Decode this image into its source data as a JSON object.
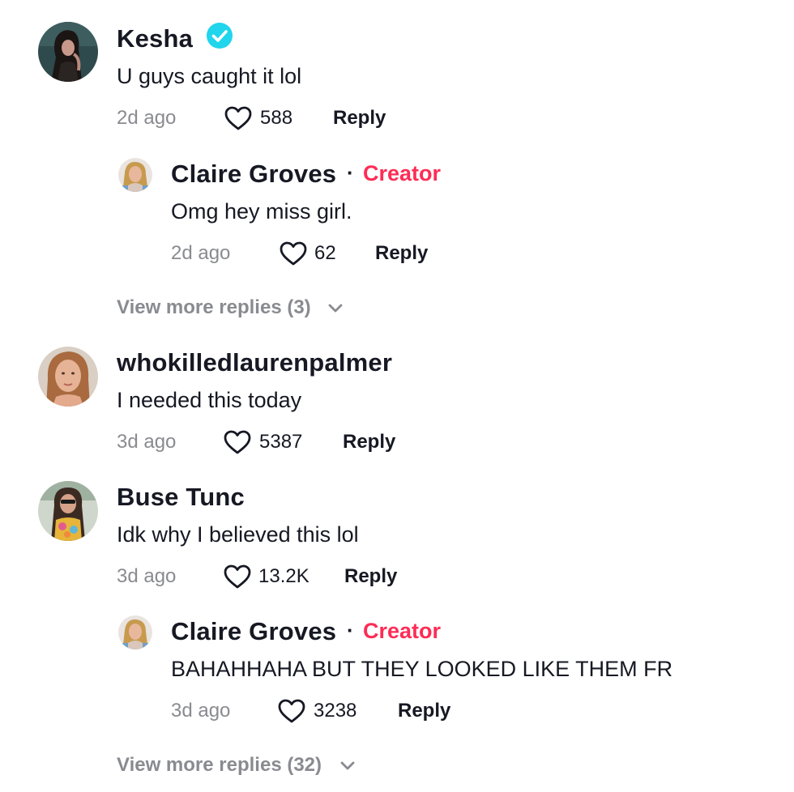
{
  "comments": [
    {
      "username": "Kesha",
      "verified": true,
      "text": "U guys caught it lol",
      "time": "2d ago",
      "likes": "588",
      "reply_label": "Reply",
      "replies": [
        {
          "username": "Claire Groves",
          "badge_separator": "·",
          "badge": "Creator",
          "text": "Omg hey miss girl.",
          "time": "2d ago",
          "likes": "62",
          "reply_label": "Reply"
        }
      ],
      "view_more": "View more replies (3)"
    },
    {
      "username": "whokilledlaurenpalmer",
      "text": "I needed this today",
      "time": "3d ago",
      "likes": "5387",
      "reply_label": "Reply"
    },
    {
      "username": "Buse Tunc",
      "text": "Idk why I believed this lol",
      "time": "3d ago",
      "likes": "13.2K",
      "reply_label": "Reply",
      "replies": [
        {
          "username": "Claire Groves",
          "badge_separator": "·",
          "badge": "Creator",
          "text": "BAHAHHAHA BUT THEY LOOKED LIKE THEM FR",
          "time": "3d ago",
          "likes": "3238",
          "reply_label": "Reply"
        }
      ],
      "view_more": "View more replies (32)"
    }
  ],
  "colors": {
    "creator_badge": "#fe2c55",
    "verified": "#20d5ec",
    "muted_text": "#8a8b91",
    "primary_text": "#161823"
  },
  "icons": {
    "like": "heart-outline-icon",
    "verified": "verified-check-icon",
    "expand": "chevron-down-icon"
  }
}
